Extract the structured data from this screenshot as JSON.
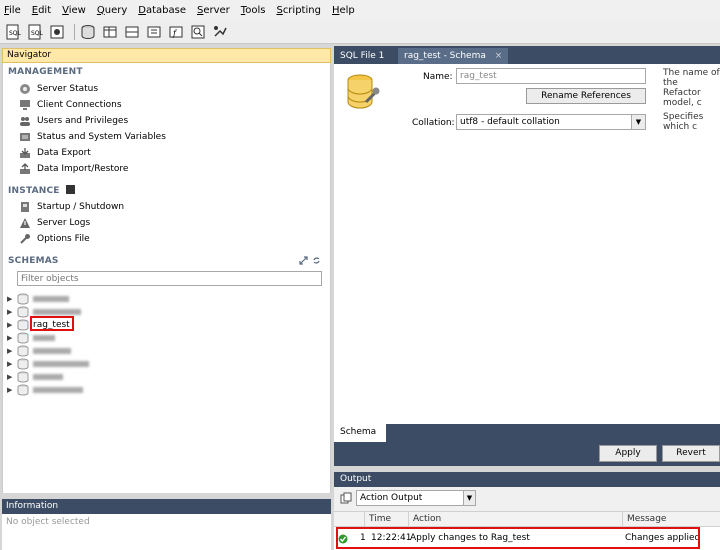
{
  "menu": [
    "File",
    "Edit",
    "View",
    "Query",
    "Database",
    "Server",
    "Tools",
    "Scripting",
    "Help"
  ],
  "navigator": {
    "title": "Navigator",
    "management": {
      "title": "MANAGEMENT",
      "items": [
        "Server Status",
        "Client Connections",
        "Users and Privileges",
        "Status and System Variables",
        "Data Export",
        "Data Import/Restore"
      ]
    },
    "instance": {
      "title": "INSTANCE",
      "items": [
        "Startup / Shutdown",
        "Server Logs",
        "Options File"
      ]
    },
    "schemas": {
      "title": "SCHEMAS",
      "filter_placeholder": "Filter objects",
      "selected": "rag_test"
    }
  },
  "information": {
    "title": "Information",
    "empty_text": "No object selected"
  },
  "editor": {
    "tabs": [
      "SQL File 1",
      "rag_test - Schema"
    ],
    "name_label": "Name:",
    "name_value": "rag_test",
    "rename_button": "Rename References",
    "collation_label": "Collation:",
    "collation_value": "utf8 - default collation",
    "help_name": "The name of the",
    "help_rename": "Refactor model, c",
    "help_collation": "Specifies which c",
    "bottom_tab": "Schema",
    "apply_button": "Apply",
    "revert_button": "Revert"
  },
  "output": {
    "title": "Output",
    "selector_value": "Action Output",
    "columns": [
      "Time",
      "Action",
      "Message"
    ],
    "rows": [
      {
        "index": "1",
        "time": "12:22:41",
        "action": "Apply changes to Rag_test",
        "message": "Changes applied",
        "status_color": "#2e9a2e"
      }
    ]
  }
}
